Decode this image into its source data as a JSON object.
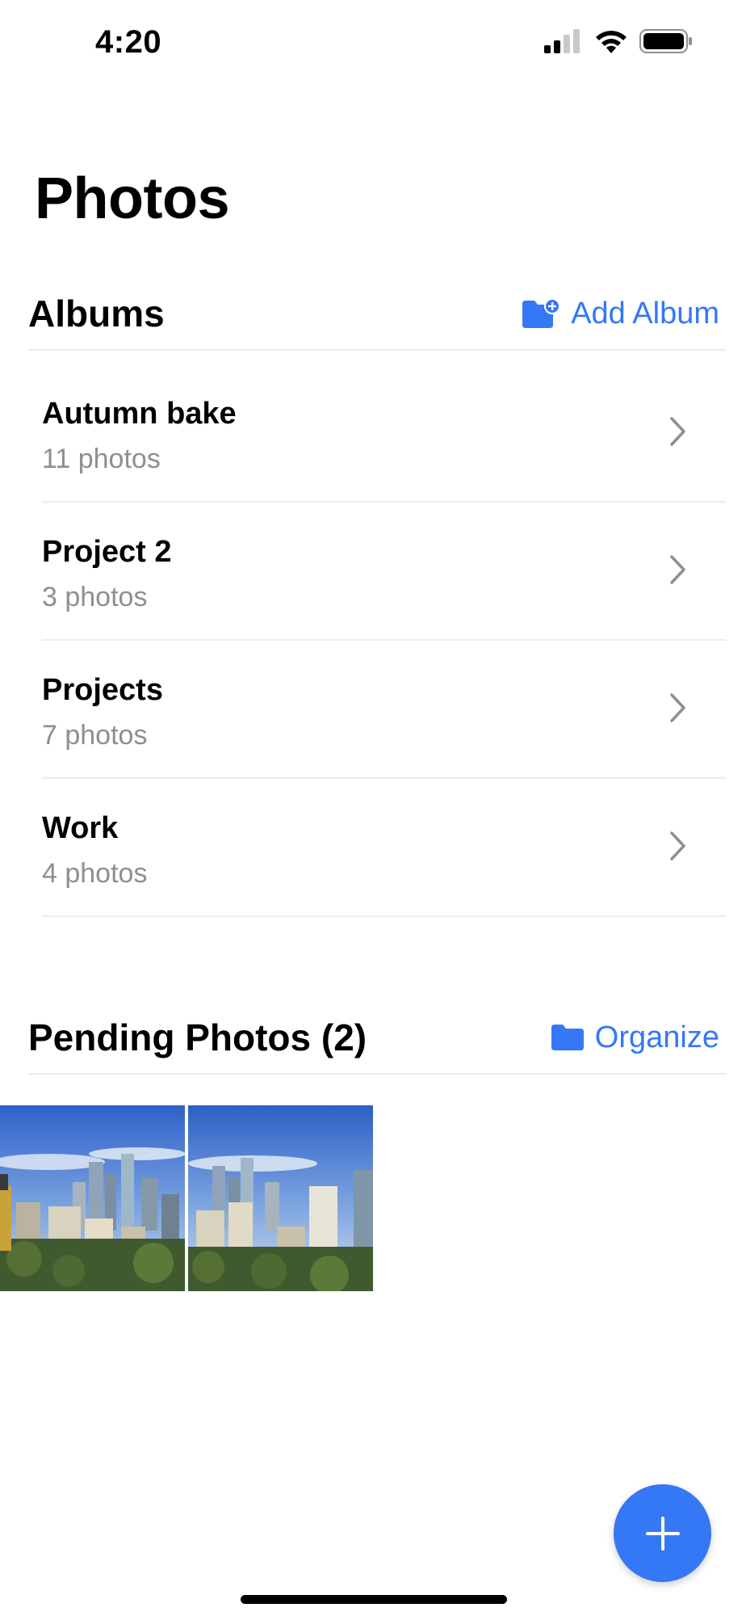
{
  "status_bar": {
    "time": "4:20"
  },
  "page": {
    "title": "Photos"
  },
  "albums_section": {
    "title": "Albums",
    "action_label": "Add Album",
    "items": [
      {
        "name": "Autumn bake",
        "count": "11 photos"
      },
      {
        "name": "Project 2",
        "count": "3 photos"
      },
      {
        "name": "Projects",
        "count": "7 photos"
      },
      {
        "name": "Work",
        "count": "4 photos"
      }
    ]
  },
  "pending_section": {
    "title": "Pending Photos (2)",
    "action_label": "Organize",
    "photo_count": 2
  },
  "colors": {
    "accent": "#3478f6",
    "secondary_text": "#8e8e93",
    "separator": "#ececec"
  },
  "icons": [
    "signal-icon",
    "wifi-icon",
    "battery-icon",
    "folder-add-icon",
    "chevron-right-icon",
    "folder-icon",
    "plus-icon"
  ]
}
